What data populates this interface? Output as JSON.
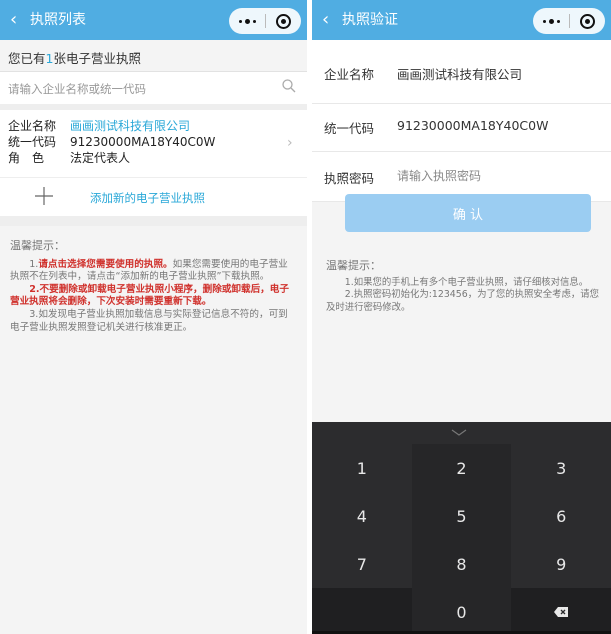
{
  "left": {
    "nav": {
      "back": "‹",
      "title": "执照列表"
    },
    "count": {
      "prefix": "您已有",
      "number": "1",
      "suffix": "张电子营业执照"
    },
    "search": {
      "placeholder": "请输入企业名称或统一代码"
    },
    "license": {
      "name_label": "企业名称",
      "name_value": "画画测试科技有限公司",
      "code_label": "统一代码",
      "code_value": "91230000MA18Y40C0W",
      "role_label": "角　色",
      "role_value": "法定代表人"
    },
    "add_label": "添加新的电子营业执照",
    "tips": {
      "heading": "温馨提示：",
      "t1_num": "1.",
      "t1_red": "请点击选择您需要使用的执照。",
      "t1_rest": "如果您需要使用的电子营业执照不在列表中，请点击“添加新的电子营业执照”下载执照。",
      "t2": "2.不要删除或卸载电子营业执照小程序，删除或卸载后，电子营业执照将会删除，下次安装时需要重新下载。",
      "t3": "3.如发现电子营业执照加载信息与实际登记信息不符的，可到电子营业执照发照登记机关进行核准更正。"
    }
  },
  "right": {
    "nav": {
      "back": "‹",
      "title": "执照验证"
    },
    "name_label": "企业名称",
    "name_value": "画画测试科技有限公司",
    "code_label": "统一代码",
    "code_value": "91230000MA18Y40C0W",
    "pwd_label": "执照密码",
    "pwd_placeholder": "请输入执照密码",
    "confirm": "确 认",
    "tips": {
      "heading": "温馨提示：",
      "t1": "1.如果您的手机上有多个电子营业执照，请仔细核对信息。",
      "t2": "2.执照密码初始化为:123456，为了您的执照安全考虑，请您及时进行密码修改。"
    },
    "keys": [
      [
        "1",
        "2",
        "3"
      ],
      [
        "4",
        "5",
        "6"
      ],
      [
        "7",
        "8",
        "9"
      ],
      [
        "",
        "0",
        "⌫"
      ]
    ]
  },
  "colors": {
    "nav": "#50ade2",
    "link": "#2aa8d8",
    "warn": "#d0322d",
    "button": "#9bcdf2",
    "keyboard": "#2c2c2e"
  }
}
